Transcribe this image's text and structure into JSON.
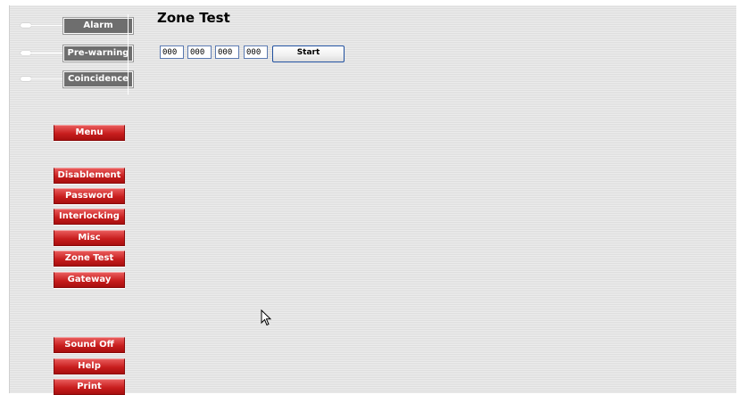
{
  "indicators": [
    {
      "label": "Alarm"
    },
    {
      "label": "Pre-warning"
    },
    {
      "label": "Coincidence"
    }
  ],
  "nav": {
    "menu": "Menu",
    "disablement": "Disablement",
    "password": "Password",
    "interlocking": "Interlocking",
    "misc": "Misc",
    "zone_test": "Zone Test",
    "gateway": "Gateway",
    "sound_off": "Sound Off",
    "help": "Help",
    "print": "Print"
  },
  "page": {
    "title": "Zone Test",
    "zone_fields": [
      "000",
      "000",
      "000",
      "000"
    ],
    "start_label": "Start"
  },
  "colors": {
    "nav_button": "#c81e1e",
    "indicator_box": "#6e6e6e",
    "input_border": "#5a79b0",
    "start_border": "#1f4f9e"
  },
  "icons": [
    "mouse-pointer-icon"
  ]
}
